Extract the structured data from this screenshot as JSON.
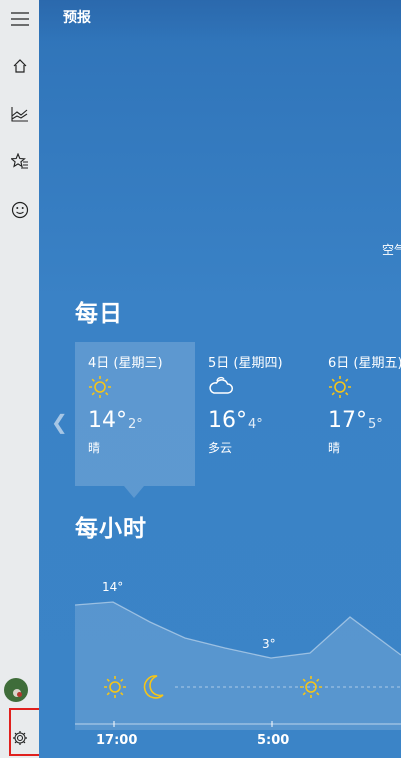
{
  "header": {
    "title": "预报"
  },
  "air_quality": {
    "label": "空气"
  },
  "daily": {
    "title": "每日",
    "days": [
      {
        "date": "4日 (星期三)",
        "icon": "sunny-icon",
        "high": "14°",
        "low": "2°",
        "condition": "晴",
        "selected": true
      },
      {
        "date": "5日 (星期四)",
        "icon": "cloudy-icon",
        "high": "16°",
        "low": "4°",
        "condition": "多云",
        "selected": false
      },
      {
        "date": "6日 (星期五)",
        "icon": "sunny-icon",
        "high": "17°",
        "low": "5°",
        "condition": "晴",
        "selected": false
      }
    ]
  },
  "hourly": {
    "title": "每小时",
    "temp_labels": [
      "14°",
      "3°"
    ],
    "time_labels": [
      "17:00",
      "5:00"
    ],
    "icons": [
      "sun-icon",
      "moon-icon",
      "sun-icon"
    ]
  },
  "colors": {
    "sidebar_bg": "#e9ebed",
    "main_bg": "#3a82c6",
    "sun": "#f5c518",
    "highlight": "#e0201e"
  },
  "sidebar": {
    "items": [
      "hamburger-menu-icon",
      "home-icon",
      "historical-chart-icon",
      "favorites-icon",
      "smiley-feedback-icon",
      "avatar",
      "settings-icon"
    ]
  }
}
